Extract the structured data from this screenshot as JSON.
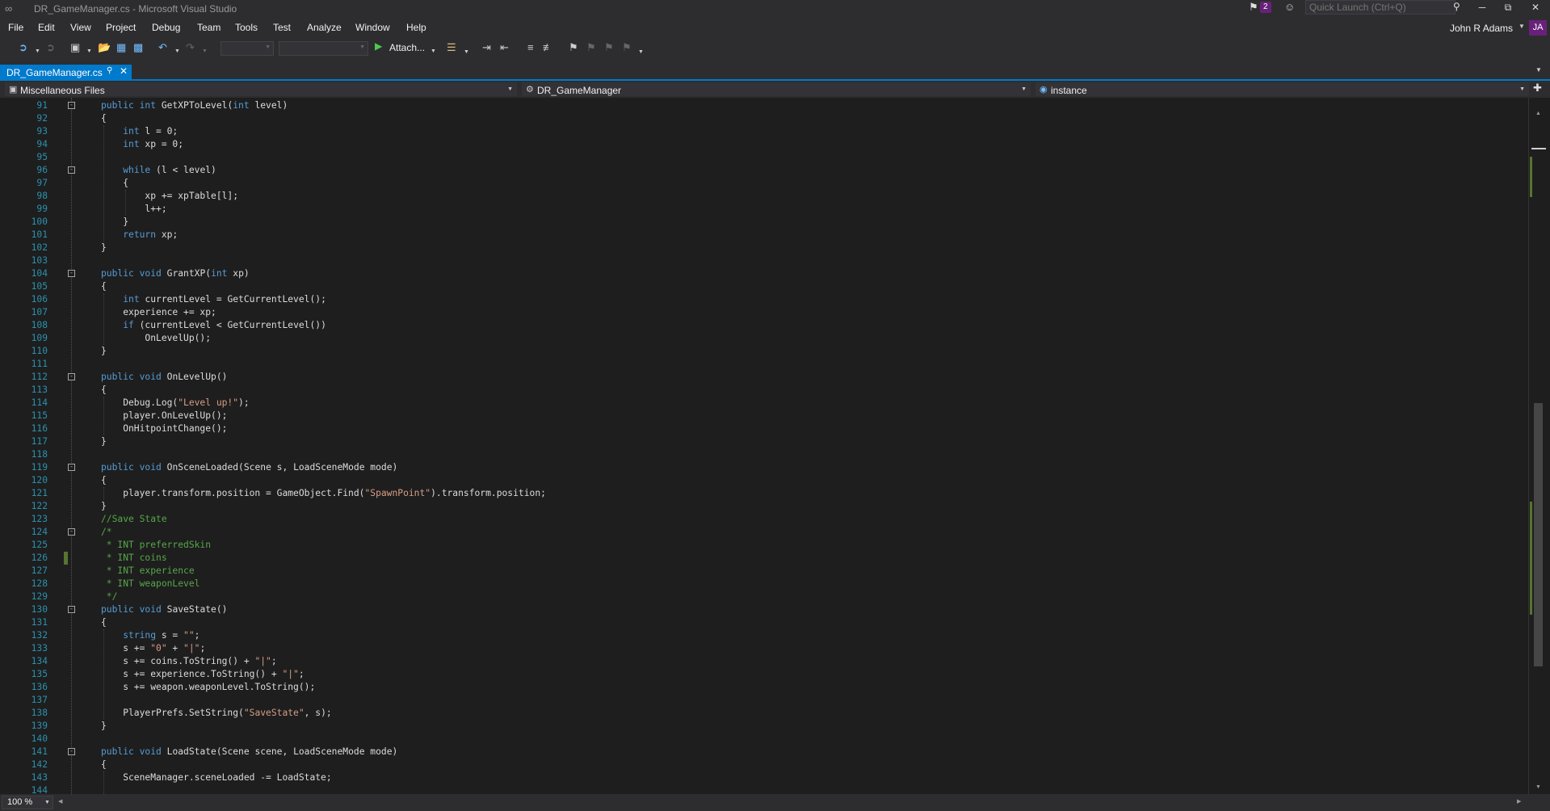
{
  "window": {
    "title": "DR_GameManager.cs - Microsoft Visual Studio",
    "logo_icon": "visual-studio-logo-icon",
    "notification_count": "2",
    "quick_launch_placeholder": "Quick Launch (Ctrl+Q)"
  },
  "menu": {
    "items": [
      "File",
      "Edit",
      "View",
      "Project",
      "Debug",
      "Team",
      "Tools",
      "Test",
      "Analyze",
      "Window",
      "Help"
    ],
    "user_name": "John R Adams",
    "user_initials": "JA"
  },
  "toolbar": {
    "attach_label": "Attach...",
    "icons": [
      "back-icon",
      "forward-icon",
      "new-project-icon",
      "open-file-icon",
      "save-icon",
      "save-all-icon",
      "undo-icon",
      "redo-icon",
      "start-icon",
      "find-icon",
      "comment-icon",
      "uncomment-icon",
      "bookmark-icon"
    ]
  },
  "tab": {
    "label": "DR_GameManager.cs"
  },
  "navbar": {
    "project": "Miscellaneous Files",
    "type": "DR_GameManager",
    "member": "instance"
  },
  "editor": {
    "zoom": "100 %",
    "lines": [
      {
        "n": "91",
        "code": "public int GetXPToLevel(int level)",
        "fold": true
      },
      {
        "n": "92",
        "code": "{"
      },
      {
        "n": "93",
        "code": "    int l = 0;"
      },
      {
        "n": "94",
        "code": "    int xp = 0;"
      },
      {
        "n": "95",
        "code": ""
      },
      {
        "n": "96",
        "code": "    while (l < level)",
        "fold": true
      },
      {
        "n": "97",
        "code": "    {"
      },
      {
        "n": "98",
        "code": "        xp += xpTable[l];"
      },
      {
        "n": "99",
        "code": "        l++;"
      },
      {
        "n": "100",
        "code": "    }"
      },
      {
        "n": "101",
        "code": "    return xp;"
      },
      {
        "n": "102",
        "code": "}"
      },
      {
        "n": "103",
        "code": ""
      },
      {
        "n": "104",
        "code": "public void GrantXP(int xp)",
        "fold": true
      },
      {
        "n": "105",
        "code": "{"
      },
      {
        "n": "106",
        "code": "    int currentLevel = GetCurrentLevel();"
      },
      {
        "n": "107",
        "code": "    experience += xp;"
      },
      {
        "n": "108",
        "code": "    if (currentLevel < GetCurrentLevel())"
      },
      {
        "n": "109",
        "code": "        OnLevelUp();"
      },
      {
        "n": "110",
        "code": "}"
      },
      {
        "n": "111",
        "code": ""
      },
      {
        "n": "112",
        "code": "public void OnLevelUp()",
        "fold": true
      },
      {
        "n": "113",
        "code": "{"
      },
      {
        "n": "114",
        "code": "    Debug.Log(\"Level up!\");"
      },
      {
        "n": "115",
        "code": "    player.OnLevelUp();"
      },
      {
        "n": "116",
        "code": "    OnHitpointChange();"
      },
      {
        "n": "117",
        "code": "}"
      },
      {
        "n": "118",
        "code": ""
      },
      {
        "n": "119",
        "code": "public void OnSceneLoaded(Scene s, LoadSceneMode mode)",
        "fold": true
      },
      {
        "n": "120",
        "code": "{"
      },
      {
        "n": "121",
        "code": "    player.transform.position = GameObject.Find(\"SpawnPoint\").transform.position;"
      },
      {
        "n": "122",
        "code": "}"
      },
      {
        "n": "123",
        "code": "//Save State"
      },
      {
        "n": "124",
        "code": "/*",
        "fold": true
      },
      {
        "n": "125",
        "code": " * INT preferredSkin"
      },
      {
        "n": "126",
        "code": " * INT coins",
        "changed": true
      },
      {
        "n": "127",
        "code": " * INT experience"
      },
      {
        "n": "128",
        "code": " * INT weaponLevel"
      },
      {
        "n": "129",
        "code": " */"
      },
      {
        "n": "130",
        "code": "public void SaveState()",
        "fold": true
      },
      {
        "n": "131",
        "code": "{"
      },
      {
        "n": "132",
        "code": "    string s = \"\";"
      },
      {
        "n": "133",
        "code": "    s += \"0\" + \"|\";"
      },
      {
        "n": "134",
        "code": "    s += coins.ToString() + \"|\";"
      },
      {
        "n": "135",
        "code": "    s += experience.ToString() + \"|\";"
      },
      {
        "n": "136",
        "code": "    s += weapon.weaponLevel.ToString();"
      },
      {
        "n": "137",
        "code": ""
      },
      {
        "n": "138",
        "code": "    PlayerPrefs.SetString(\"SaveState\", s);"
      },
      {
        "n": "139",
        "code": "}"
      },
      {
        "n": "140",
        "code": ""
      },
      {
        "n": "141",
        "code": "public void LoadState(Scene scene, LoadSceneMode mode)",
        "fold": true
      },
      {
        "n": "142",
        "code": "{"
      },
      {
        "n": "143",
        "code": "    SceneManager.sceneLoaded -= LoadState;"
      },
      {
        "n": "144",
        "code": ""
      }
    ]
  },
  "colors": {
    "accent": "#007acc",
    "keyword": "#569cd6",
    "string": "#d69d85",
    "comment": "#57a64a",
    "line_number": "#2b91af",
    "change_mark": "#577430",
    "background": "#1e1e1e",
    "chrome": "#2d2d30"
  }
}
